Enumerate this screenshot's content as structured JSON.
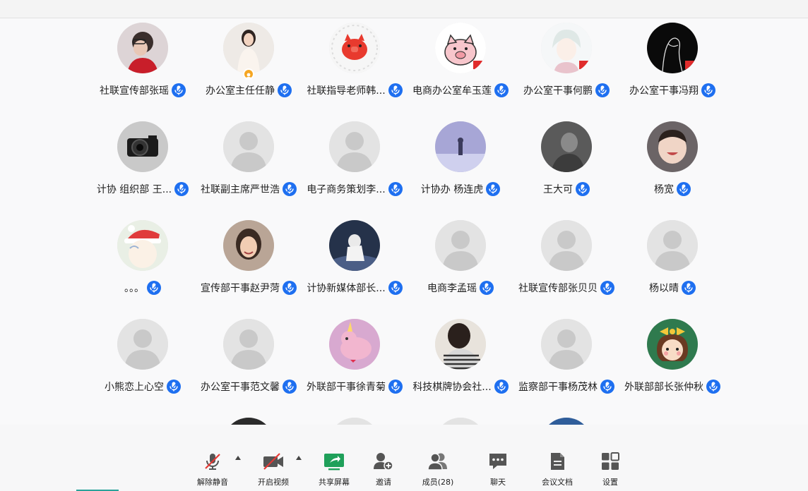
{
  "participants": [
    {
      "name": "社联宣传部张瑶",
      "avatar": "photo-woman-red-scarf"
    },
    {
      "name": "办公室主任任静",
      "avatar": "photo-woman-white-dress"
    },
    {
      "name": "社联指导老师韩...",
      "avatar": "cartoon-red-pig"
    },
    {
      "name": "电商办公室牟玉莲",
      "avatar": "cartoon-pig-sticker"
    },
    {
      "name": "办公室干事何鹏",
      "avatar": "anime-boy"
    },
    {
      "name": "办公室干事冯翔",
      "avatar": "line-drawing-black"
    },
    {
      "name": "计协 组织部 王...",
      "avatar": "photo-camera"
    },
    {
      "name": "社联副主席严世浩",
      "avatar": "default-silhouette"
    },
    {
      "name": "电子商务策划李...",
      "avatar": "default-silhouette"
    },
    {
      "name": "计协办 杨连虎",
      "avatar": "photo-purple-sky"
    },
    {
      "name": "王大可",
      "avatar": "photo-dark-portrait"
    },
    {
      "name": "杨宽",
      "avatar": "photo-smiling-child"
    },
    {
      "name": "。。。",
      "avatar": "anime-santa-hat"
    },
    {
      "name": "宣传部干事赵尹菏",
      "avatar": "photo-girl-smiling"
    },
    {
      "name": "计协新媒体部长...",
      "avatar": "illustration-runner"
    },
    {
      "name": "电商李孟瑶",
      "avatar": "default-silhouette"
    },
    {
      "name": "社联宣传部张贝贝",
      "avatar": "default-silhouette"
    },
    {
      "name": "杨以晴",
      "avatar": "default-silhouette"
    },
    {
      "name": "小熊恋上心空",
      "avatar": "default-silhouette"
    },
    {
      "name": "办公室干事范文馨",
      "avatar": "default-silhouette"
    },
    {
      "name": "外联部干事徐青菊",
      "avatar": "cartoon-pink-unicorn"
    },
    {
      "name": "科技棋牌协会社...",
      "avatar": "photo-striped-shirt"
    },
    {
      "name": "监察部干事杨茂林",
      "avatar": "default-silhouette"
    },
    {
      "name": "外联部部长张仲秋",
      "avatar": "cartoon-girl-bow"
    }
  ],
  "toolbar": {
    "unmute": "解除静音",
    "start_video": "开启视频",
    "share_screen": "共享屏幕",
    "invite": "邀请",
    "members": "成员(28)",
    "chat": "聊天",
    "meeting_docs": "会议文档",
    "settings": "设置"
  },
  "colors": {
    "mic_badge": "#1e6ff0",
    "share_green": "#1fa05a",
    "muted_red": "#e53935",
    "host_badge": "#f5a623"
  }
}
